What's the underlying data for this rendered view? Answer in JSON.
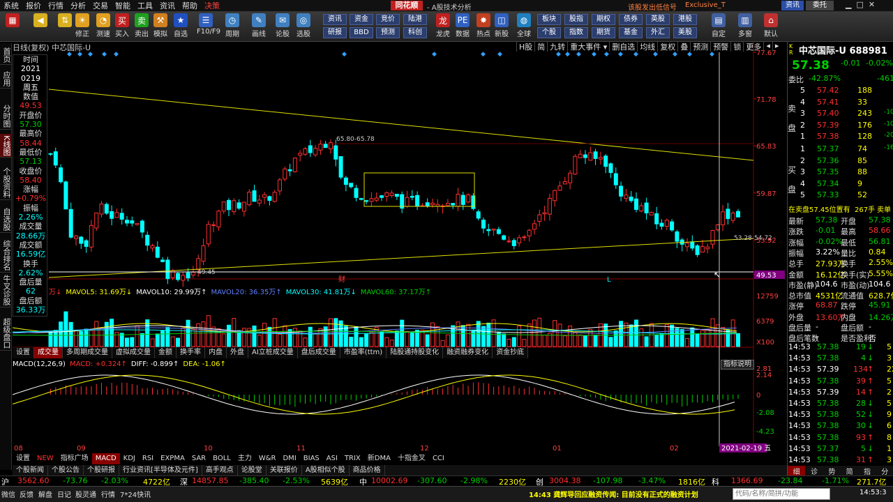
{
  "menu": [
    "系统",
    "报价",
    "行情",
    "分析",
    "交易",
    "智能",
    "工具",
    "资讯",
    "帮助",
    "决策"
  ],
  "app_logo": "同花顺",
  "app_subtitle": "- A股技术分析",
  "menu_right": {
    "promo": "该股发出低信号",
    "version": "Exclusive_T",
    "info_btn": "资讯",
    "user_btn": "委托"
  },
  "toolbar": [
    {
      "label": "",
      "icon": "grid-icon",
      "c": "#c02020"
    },
    {
      "label": "",
      "icon": "back-icon",
      "c": "#d8b020"
    },
    {
      "label": "",
      "icon": "updown-icon",
      "c": "#d8b020"
    },
    {
      "label": "修正",
      "icon": "sun-icon",
      "c": "#e0a020"
    },
    {
      "label": "测速",
      "icon": "clock-icon",
      "c": "#e0a020"
    },
    {
      "label": "买入",
      "icon": "buy-icon",
      "c": "#c02020"
    },
    {
      "label": "卖出",
      "icon": "sell-icon",
      "c": "#20a020"
    },
    {
      "label": "模拟",
      "icon": "hammer-icon",
      "c": "#d08020"
    },
    {
      "label": "自选",
      "icon": "star-icon",
      "c": "#2050c0"
    },
    {
      "label": "F10/F9",
      "icon": "list-icon",
      "c": "#3060c0"
    },
    {
      "label": "周期",
      "icon": "clock2-icon",
      "c": "#4080c0"
    },
    {
      "label": "画线",
      "icon": "pen-icon",
      "c": "#4080c0"
    },
    {
      "label": "论股",
      "icon": "chat-icon",
      "c": "#4080c0"
    },
    {
      "label": "选股",
      "icon": "target-icon",
      "c": "#4080c0"
    }
  ],
  "toolbar_btns": [
    [
      "资讯",
      "研报"
    ],
    [
      "资金",
      "BBD"
    ],
    [
      "竞价",
      "预测"
    ],
    [
      "陆港",
      "科创"
    ]
  ],
  "toolbar2": [
    {
      "label": "龙虎",
      "icon": "dragon-icon",
      "c": "#c02020"
    },
    {
      "label": "数据",
      "icon": "pe-icon",
      "c": "#3060c0"
    },
    {
      "label": "热点",
      "icon": "hot-icon",
      "c": "#c04020"
    },
    {
      "label": "新股",
      "icon": "new-icon",
      "c": "#3060c0"
    },
    {
      "label": "全球",
      "icon": "globe-icon",
      "c": "#2080c0"
    }
  ],
  "toolbar_btns2": [
    [
      "板块",
      "个股"
    ],
    [
      "股指",
      "指数"
    ],
    [
      "期权",
      "期货"
    ],
    [
      "债券",
      "基金"
    ],
    [
      "英股",
      "外汇"
    ],
    [
      "港股",
      "美股"
    ]
  ],
  "toolbar3": [
    {
      "label": "自定",
      "icon": "custom-icon",
      "c": "#4060a0"
    },
    {
      "label": "多窗",
      "icon": "window-icon",
      "c": "#4060a0"
    },
    {
      "label": "默认",
      "icon": "home-icon",
      "c": "#c03030"
    }
  ],
  "left_nav": [
    {
      "label": "首页",
      "active": false
    },
    {
      "label": "应用",
      "active": false
    },
    {
      "label": "分时图",
      "active": false
    },
    {
      "label": "K线图",
      "active": true
    },
    {
      "label": "个股资料",
      "active": false
    },
    {
      "label": "自选股",
      "active": false
    },
    {
      "label": "综合排名",
      "active": false
    },
    {
      "label": "牛叉诊股",
      "active": false
    },
    {
      "label": "超级盘口",
      "active": false
    }
  ],
  "chart": {
    "title": "日线(复权)  中芯国际-U",
    "toolbar": [
      "H股",
      "简",
      "九转",
      "重大事件 ▾",
      "删自选",
      "均线",
      "复权",
      "叠",
      "预测",
      "预警",
      "锁",
      "更多",
      "◂",
      "▸"
    ],
    "price_ticks": [
      "77.67",
      "71.78",
      "65.83",
      "59.87",
      "53.92",
      "49.53"
    ],
    "vol_ticks": [
      "12759",
      "6379",
      "X100"
    ],
    "macd_ticks": [
      "2.81",
      "2.14",
      "0",
      "-2.08",
      "-4.23"
    ],
    "date_ticks": [
      "08",
      "09",
      "10",
      "11",
      "12",
      "01",
      "02"
    ],
    "box_label": "65.80-65.78",
    "range_label": "53.28-54.72",
    "low_label": "49.45",
    "cross_date": "2021-02-19 五",
    "marker_cai": "财",
    "marker_L": "L",
    "vol_header": [
      {
        "t": "万↓",
        "c": "red"
      },
      {
        "t": "MAVOL5: 31.69万↓",
        "c": "yel"
      },
      {
        "t": "MAVOL10: 29.99万↑",
        "c": "wht"
      },
      {
        "t": "MAVOL20: 36.35万↑",
        "c": "blu"
      },
      {
        "t": "MAVOL30: 41.81万↓",
        "c": "cyan"
      },
      {
        "t": "MAVOL60: 37.17万↑",
        "c": "grn"
      }
    ],
    "tabs1": [
      "设置",
      "成交量",
      "多周期成交量",
      "虚拟成交量",
      "金额",
      "换手率",
      "内盘",
      "外盘",
      "AI立桩成交量",
      "盘后成交量",
      "市盈率(ttm)",
      "陆股通持股变化",
      "融资融券变化",
      "资金抄底"
    ],
    "macd_header": [
      {
        "t": "MACD(12,26,9)",
        "c": "wht"
      },
      {
        "t": "MACD: +0.324↑",
        "c": "red"
      },
      {
        "t": "DIFF: -0.899↑",
        "c": "wht"
      },
      {
        "t": "DEA: -1.06↑",
        "c": "yel"
      }
    ],
    "indicator_btn": "指标说明",
    "tabs2": [
      "设置",
      "NEW",
      "指标广场",
      "MACD",
      "KDJ",
      "RSI",
      "EXPMA",
      "SAR",
      "BOLL",
      "主力",
      "W&R",
      "DMI",
      "BIAS",
      "ASI",
      "TRIX",
      "新DMA",
      "十指金叉",
      "CCI"
    ],
    "tabs3": [
      "个股新闻",
      "个股公告",
      "个股研报",
      "行业资讯[半导体及元件]",
      "高手观点",
      "论股堂",
      "关联报价",
      "A股相似个股",
      "商品价格"
    ]
  },
  "data_window": [
    {
      "t": "时间",
      "c": "lbl"
    },
    {
      "t": "2021",
      "c": "wht"
    },
    {
      "t": "0219",
      "c": "wht"
    },
    {
      "t": "周五",
      "c": "wht"
    },
    {
      "t": "数值",
      "c": "lbl"
    },
    {
      "t": "49.53",
      "c": "red"
    },
    {
      "t": "开盘价",
      "c": "lbl"
    },
    {
      "t": "57.30",
      "c": "grn"
    },
    {
      "t": "最高价",
      "c": "lbl"
    },
    {
      "t": "58.44",
      "c": "red"
    },
    {
      "t": "最低价",
      "c": "lbl"
    },
    {
      "t": "57.13",
      "c": "grn"
    },
    {
      "t": "收盘价",
      "c": "lbl"
    },
    {
      "t": "58.40",
      "c": "red"
    },
    {
      "t": "涨幅",
      "c": "lbl"
    },
    {
      "t": "+0.79%",
      "c": "red"
    },
    {
      "t": "振幅",
      "c": "lbl"
    },
    {
      "t": "2.26%",
      "c": "cyan"
    },
    {
      "t": "成交量",
      "c": "lbl"
    },
    {
      "t": "28.66万",
      "c": "cyan"
    },
    {
      "t": "成交额",
      "c": "lbl"
    },
    {
      "t": "16.59亿",
      "c": "cyan"
    },
    {
      "t": "换手",
      "c": "lbl"
    },
    {
      "t": "2.62%",
      "c": "cyan"
    },
    {
      "t": "盘后量",
      "c": "lbl"
    },
    {
      "t": "62",
      "c": "cyan"
    },
    {
      "t": "盘后额",
      "c": "lbl"
    },
    {
      "t": "36.33万",
      "c": "cyan"
    }
  ],
  "quote": {
    "name": "中芯国际-U 688981",
    "price": "57.38",
    "change": "-0.01",
    "pct": "-0.02%",
    "webi_label": "委比",
    "webi": "-42.87%",
    "webi_diff": "-461",
    "sell_label": "卖盘",
    "buy_label": "买盘",
    "asks": [
      {
        "lvl": "5",
        "p": "57.42",
        "v": "188",
        "d": ""
      },
      {
        "lvl": "4",
        "p": "57.41",
        "v": "33",
        "d": ""
      },
      {
        "lvl": "3",
        "p": "57.40",
        "v": "243",
        "d": "-10"
      },
      {
        "lvl": "2",
        "p": "57.39",
        "v": "176",
        "d": "-10"
      },
      {
        "lvl": "1",
        "p": "57.38",
        "v": "128",
        "d": "-20"
      }
    ],
    "bids": [
      {
        "lvl": "1",
        "p": "57.37",
        "v": "74",
        "d": "-16"
      },
      {
        "lvl": "2",
        "p": "57.36",
        "v": "85",
        "d": ""
      },
      {
        "lvl": "3",
        "p": "57.35",
        "v": "88",
        "d": ""
      },
      {
        "lvl": "4",
        "p": "57.34",
        "v": "9",
        "d": ""
      },
      {
        "lvl": "5",
        "p": "57.33",
        "v": "52",
        "d": ""
      }
    ],
    "pending": "在卖盘57.45位置有",
    "pending_vol": "267手",
    "pending_tag": "卖单",
    "stats": [
      [
        "最新",
        "57.38",
        "grn",
        "开盘",
        "57.38",
        "grn"
      ],
      [
        "涨跌",
        "-0.01",
        "grn",
        "最高",
        "58.66",
        "red"
      ],
      [
        "涨幅",
        "-0.02%",
        "grn",
        "最低",
        "56.81",
        "grn"
      ],
      [
        "振幅",
        "3.22%",
        "wht",
        "量比",
        "0.84",
        "yel"
      ],
      [
        "总手",
        "27.93万",
        "yel",
        "换手",
        "2.55%",
        "yel"
      ],
      [
        "金额",
        "16.12亿",
        "yel",
        "换手(实)",
        "5.55%",
        "yel"
      ],
      [
        "市盈(静)",
        "104.6",
        "wht",
        "市盈(动)",
        "104.6",
        "wht"
      ],
      [
        "总市值",
        "4531亿",
        "yel",
        "流通值",
        "628.7亿",
        "yel"
      ],
      [
        "涨停",
        "68.87",
        "red",
        "跌停",
        "45.91",
        "grn"
      ],
      [
        "外盘",
        "13.60万",
        "red",
        "内盘",
        "14.26万",
        "grn"
      ],
      [
        "盘后量",
        "-",
        "wht",
        "盘后额",
        "-",
        "wht"
      ],
      [
        "盘后笔数",
        "-",
        "wht",
        "是否盈利",
        "否",
        "wht"
      ]
    ],
    "ticks": [
      {
        "t": "14:53",
        "p": "57.38",
        "pc": "grn",
        "v": "19",
        "a": "↓",
        "x": "5"
      },
      {
        "t": "14:53",
        "p": "57.38",
        "pc": "grn",
        "v": "4",
        "a": "↓",
        "x": "3"
      },
      {
        "t": "14:53",
        "p": "57.39",
        "pc": "wht",
        "v": "134",
        "a": "↑",
        "x": "22"
      },
      {
        "t": "14:53",
        "p": "57.38",
        "pc": "grn",
        "v": "39",
        "a": "↑",
        "x": "5"
      },
      {
        "t": "14:53",
        "p": "57.39",
        "pc": "wht",
        "v": "14",
        "a": "↑",
        "x": "2"
      },
      {
        "t": "14:53",
        "p": "57.38",
        "pc": "grn",
        "v": "28",
        "a": "↓",
        "x": "5"
      },
      {
        "t": "14:53",
        "p": "57.38",
        "pc": "grn",
        "v": "52",
        "a": "↓",
        "x": "9"
      },
      {
        "t": "14:53",
        "p": "57.38",
        "pc": "grn",
        "v": "30",
        "a": "↓",
        "x": "6"
      },
      {
        "t": "14:53",
        "p": "57.38",
        "pc": "grn",
        "v": "93",
        "a": "↑",
        "x": "8"
      },
      {
        "t": "14:53",
        "p": "57.37",
        "pc": "grn",
        "v": "5",
        "a": "↓",
        "x": "1"
      },
      {
        "t": "14:53",
        "p": "57.38",
        "pc": "grn",
        "v": "31",
        "a": "↑",
        "x": "3"
      }
    ],
    "bottom_tabs": [
      "细",
      "诊",
      "势",
      "简",
      "指",
      "分"
    ]
  },
  "status": [
    {
      "t": "沪",
      "c": "wht"
    },
    {
      "t": "3562.60",
      "c": "red"
    },
    {
      "t": "-73.76",
      "c": "grn"
    },
    {
      "t": "-2.03%",
      "c": "grn"
    },
    {
      "t": "4722亿",
      "c": "yel"
    },
    {
      "t": "深",
      "c": "wht"
    },
    {
      "t": "14857.85",
      "c": "red"
    },
    {
      "t": "-385.40",
      "c": "grn"
    },
    {
      "t": "-2.53%",
      "c": "grn"
    },
    {
      "t": "5639亿",
      "c": "yel"
    },
    {
      "t": "中",
      "c": "wht"
    },
    {
      "t": "10002.69",
      "c": "red"
    },
    {
      "t": "-307.60",
      "c": "grn"
    },
    {
      "t": "-2.98%",
      "c": "grn"
    },
    {
      "t": "2230亿",
      "c": "yel"
    },
    {
      "t": "创",
      "c": "wht"
    },
    {
      "t": "3004.38",
      "c": "red"
    },
    {
      "t": "-107.98",
      "c": "grn"
    },
    {
      "t": "-3.47%",
      "c": "grn"
    },
    {
      "t": "1816亿",
      "c": "yel"
    },
    {
      "t": "科",
      "c": "wht"
    },
    {
      "t": "1366.69",
      "c": "red"
    },
    {
      "t": "-23.84",
      "c": "grn"
    },
    {
      "t": "-1.71%",
      "c": "grn"
    },
    {
      "t": "271.7亿",
      "c": "yel"
    }
  ],
  "bottom": {
    "items": [
      "微信",
      "反馈",
      "解盘",
      "日记",
      "股灵通",
      "行情",
      "7*24快讯"
    ],
    "news": "14:43 龚辉导回应融资传闻: 目前没有正式的融资计划",
    "search_placeholder": "代码/名称/简拼/功能",
    "time": "14:53:3"
  },
  "colors": {
    "up": "#ff3030",
    "down": "#00ffff",
    "ma_yellow": "#ffff00",
    "bg": "#000000"
  }
}
